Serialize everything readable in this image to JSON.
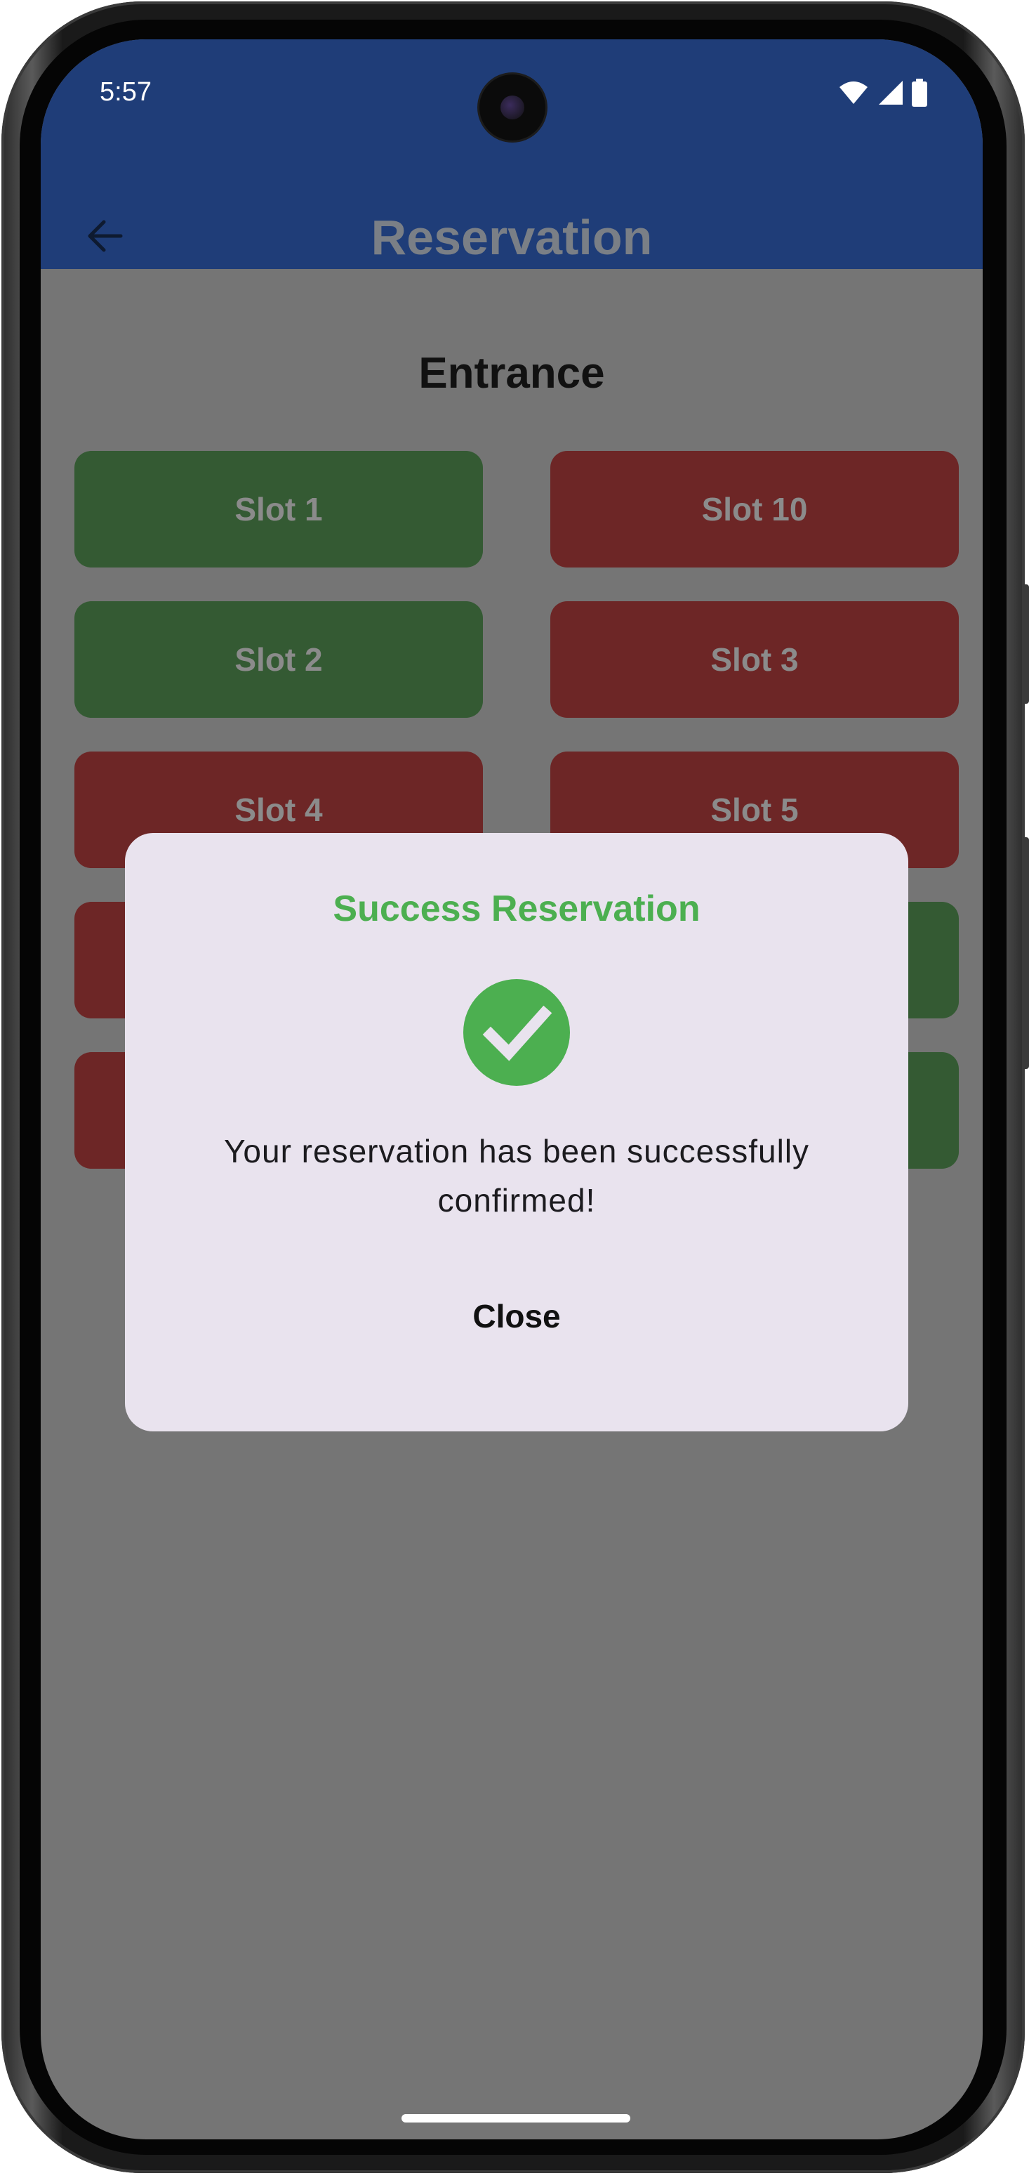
{
  "status_bar": {
    "time": "5:57",
    "icons": [
      "wifi-icon",
      "signal-icon",
      "battery-icon"
    ]
  },
  "app_bar": {
    "title": "Reservation",
    "back_icon": "arrow-left-icon",
    "background_color": "#1f3d78"
  },
  "section": {
    "title": "Entrance"
  },
  "slots": [
    {
      "label": "Slot 1",
      "status": "available",
      "color": "#345a33"
    },
    {
      "label": "Slot 10",
      "status": "reserved",
      "color": "#6d2626"
    },
    {
      "label": "Slot 2",
      "status": "available",
      "color": "#345a33"
    },
    {
      "label": "Slot 3",
      "status": "reserved",
      "color": "#6d2626"
    },
    {
      "label": "Slot 4",
      "status": "reserved",
      "color": "#6d2626"
    },
    {
      "label": "Slot 5",
      "status": "reserved",
      "color": "#6d2626"
    }
  ],
  "dialog": {
    "title": "Success Reservation",
    "icon": "check-circle-icon",
    "message": "Your reservation has been successfully confirmed!",
    "close_label": "Close",
    "accent_color": "#4caf50"
  }
}
